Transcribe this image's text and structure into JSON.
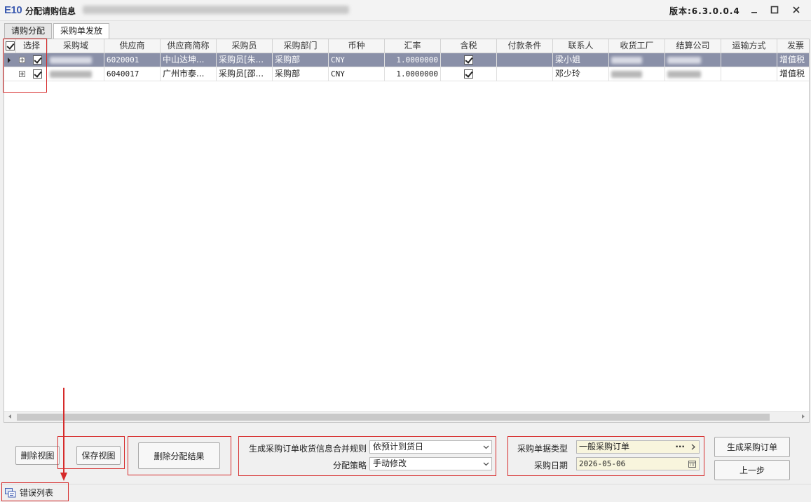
{
  "window": {
    "logo": "E10",
    "title": "分配请购信息",
    "version": "版本:6.3.0.0.4"
  },
  "tabs": [
    {
      "label": "请购分配",
      "active": false
    },
    {
      "label": "采购单发放",
      "active": true
    }
  ],
  "grid": {
    "columns": [
      "选择",
      "采购域",
      "供应商",
      "供应商简称",
      "采购员",
      "采购部门",
      "币种",
      "汇率",
      "含税",
      "付款条件",
      "联系人",
      "收货工厂",
      "结算公司",
      "运输方式",
      "发票"
    ],
    "rows": [
      {
        "selected": true,
        "checked": true,
        "supplier": "6020001",
        "supplier_short": "中山达坤...",
        "buyer": "采购员[朱...",
        "dept": "采购部",
        "currency": "CNY",
        "rate": "1.0000000",
        "tax_included": true,
        "payment": "",
        "contact": "梁小姐",
        "invoice": "增值税"
      },
      {
        "selected": false,
        "checked": true,
        "supplier": "6040017",
        "supplier_short": "广州市泰...",
        "buyer": "采购员[邵...",
        "dept": "采购部",
        "currency": "CNY",
        "rate": "1.0000000",
        "tax_included": true,
        "payment": "",
        "contact": "邓少玲",
        "invoice": "增值税"
      }
    ]
  },
  "buttons": {
    "delete_view": "删除视图",
    "save_view": "保存视图",
    "delete_result": "删除分配结果",
    "generate_po": "生成采购订单",
    "prev_step": "上一步"
  },
  "merge_rule": {
    "label": "生成采购订单收货信息合并规则",
    "value": "依预计到货日"
  },
  "strategy": {
    "label": "分配策略",
    "value": "手动修改"
  },
  "doc_type": {
    "label": "采购单据类型",
    "value": "一般采购订单"
  },
  "po_date": {
    "label": "采购日期",
    "value": "2026-05-06"
  },
  "status": {
    "error_list": "错误列表"
  },
  "colors": {
    "selected_row": "#8a90a8",
    "highlight": "#d62a2a",
    "field_bg": "#f8f5dd"
  }
}
